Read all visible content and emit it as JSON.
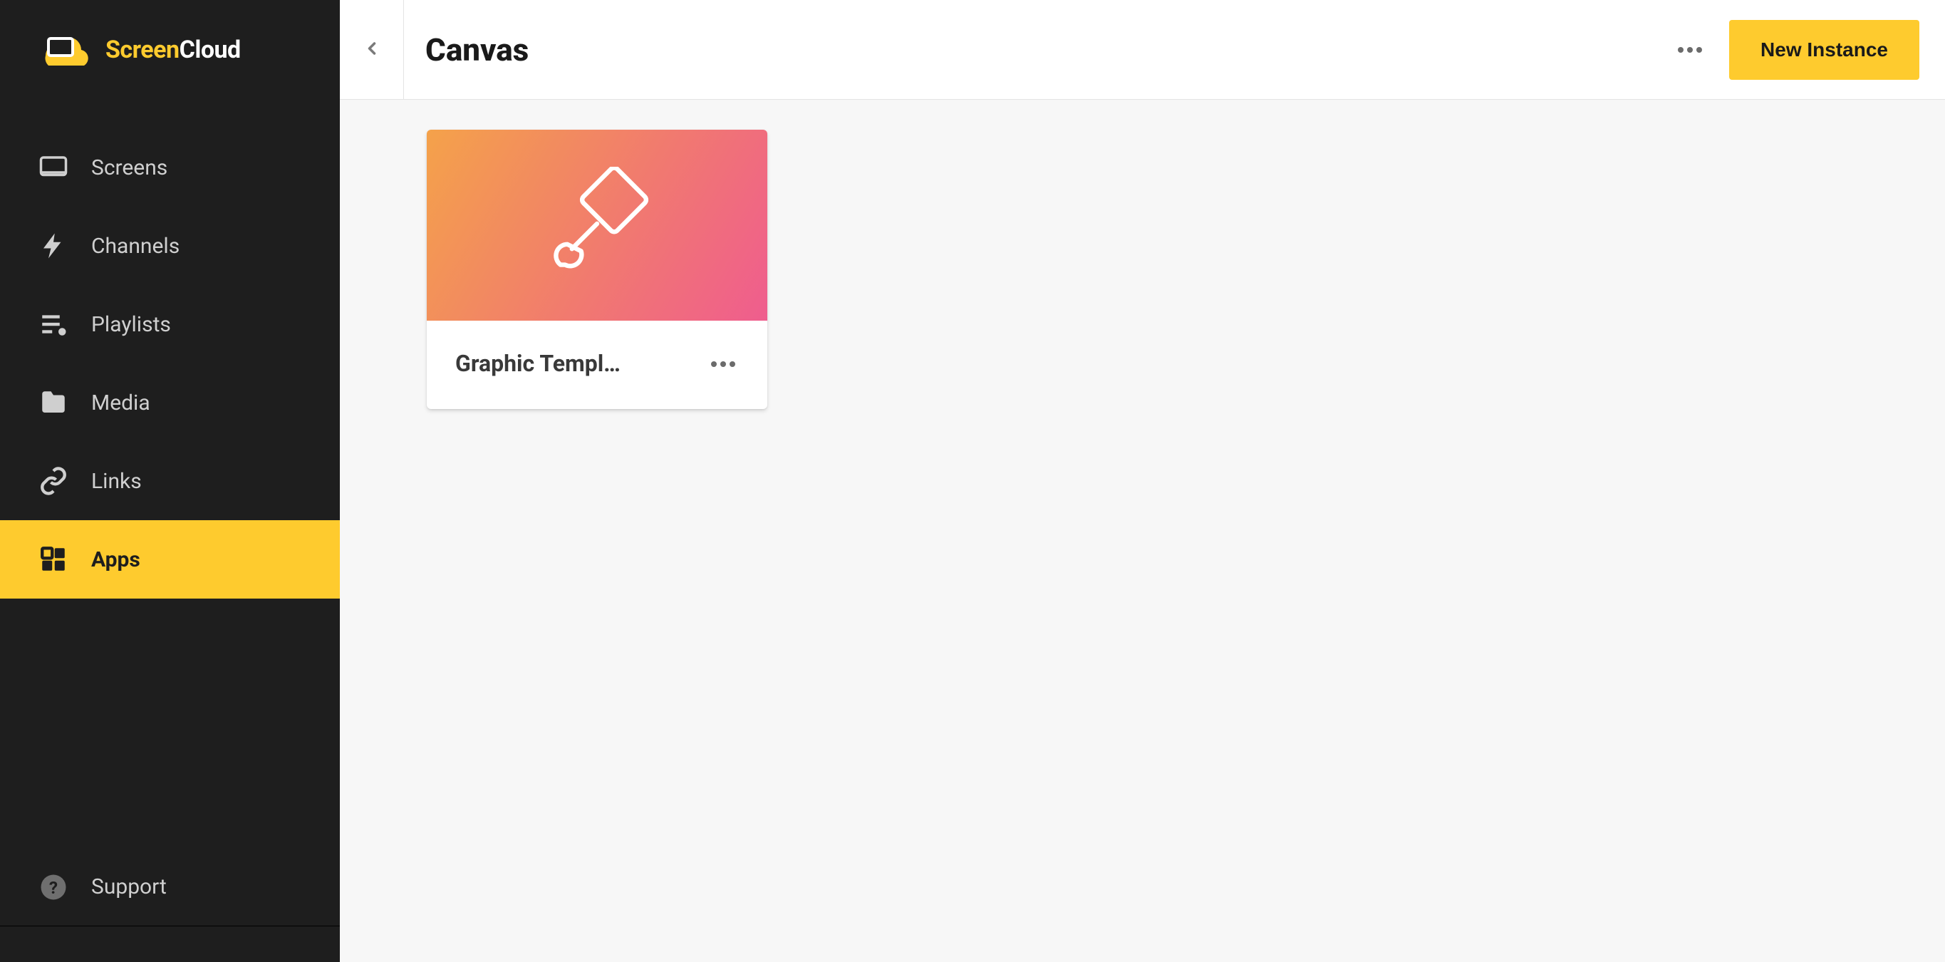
{
  "brand": {
    "part1": "Screen",
    "part2": "Cloud"
  },
  "sidebar": {
    "items": [
      {
        "id": "screens",
        "label": "Screens",
        "icon": "screen-icon",
        "active": false
      },
      {
        "id": "channels",
        "label": "Channels",
        "icon": "bolt-icon",
        "active": false
      },
      {
        "id": "playlists",
        "label": "Playlists",
        "icon": "playlist-icon",
        "active": false
      },
      {
        "id": "media",
        "label": "Media",
        "icon": "folder-icon",
        "active": false
      },
      {
        "id": "links",
        "label": "Links",
        "icon": "link-icon",
        "active": false
      },
      {
        "id": "apps",
        "label": "Apps",
        "icon": "apps-icon",
        "active": true
      }
    ],
    "support_label": "Support"
  },
  "header": {
    "page_title": "Canvas",
    "new_instance_label": "New Instance"
  },
  "cards": [
    {
      "title": "Graphic Templ…",
      "icon": "brush-icon"
    }
  ],
  "colors": {
    "accent": "#fecb2e",
    "sidebar_bg": "#1e1e1e",
    "card_gradient_start": "#f4a24a",
    "card_gradient_end": "#ef5d8e"
  }
}
